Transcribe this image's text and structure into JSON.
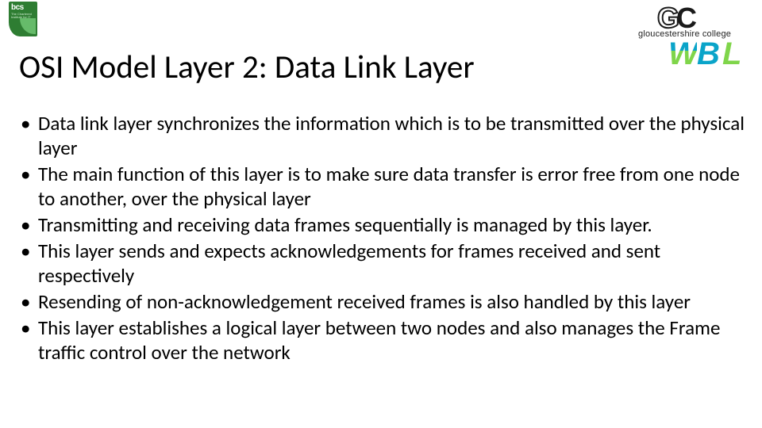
{
  "logos": {
    "bcs": {
      "name": "bcs",
      "subtext": "The Chartered Institute for IT"
    },
    "gc": {
      "mark_g": "G",
      "mark_c": "C",
      "text": "gloucestershire college"
    },
    "wbl": {
      "w": "W",
      "b": "B",
      "l": "L"
    }
  },
  "title": "OSI Model Layer 2: Data Link Layer",
  "bullets": [
    "Data link layer synchronizes the information which is to be transmitted over the physical layer",
    "The main function of this layer is to make sure data transfer is error free from one node to another, over the physical layer",
    "Transmitting and receiving data frames sequentially is managed by this layer.",
    "This layer sends and expects acknowledgements for frames received and sent respectively",
    "Resending of non-acknowledgement received frames is also handled by this layer",
    "This layer establishes a logical layer between two nodes and also manages the Frame traffic control over the network"
  ]
}
